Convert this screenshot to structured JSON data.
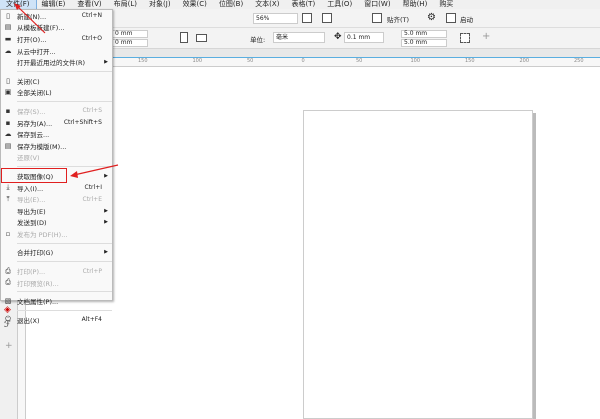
{
  "menubar": [
    "文件(F)",
    "编辑(E)",
    "查看(V)",
    "布局(L)",
    "对象(J)",
    "效果(C)",
    "位图(B)",
    "文本(X)",
    "表格(T)",
    "工具(O)",
    "窗口(W)",
    "帮助(H)",
    "购买"
  ],
  "toolbar": {
    "zoom": "56%",
    "snap": "贴齐(T)",
    "launch": "启动",
    "x_val": "0 mm",
    "y_val": "0 mm",
    "unit_label": "单位:",
    "unit": "毫米",
    "nudge": "0.1 mm",
    "dup_x": "5.0 mm",
    "dup_y": "5.0 mm"
  },
  "ruler": [
    "150",
    "100",
    "50",
    "0",
    "50",
    "100",
    "150",
    "200",
    "250"
  ],
  "file_menu": [
    {
      "icon": "new-icon",
      "label": "新建(N)...",
      "shortcut": "Ctrl+N"
    },
    {
      "icon": "template-icon",
      "label": "从模板新建(F)..."
    },
    {
      "icon": "folder-icon",
      "label": "打开(O)...",
      "shortcut": "Ctrl+O"
    },
    {
      "icon": "cloud-icon",
      "label": "从云中打开..."
    },
    {
      "label": "打开最近用过的文件(R)",
      "submenu": true
    },
    {
      "sep": true
    },
    {
      "icon": "close-icon",
      "label": "关闭(C)"
    },
    {
      "icon": "close-all-icon",
      "label": "全部关闭(L)"
    },
    {
      "sep": true
    },
    {
      "icon": "save-icon",
      "label": "保存(S)...",
      "shortcut": "Ctrl+S",
      "disabled": true
    },
    {
      "icon": "save-as-icon",
      "label": "另存为(A)...",
      "shortcut": "Ctrl+Shift+S"
    },
    {
      "icon": "cloud-save-icon",
      "label": "保存到云..."
    },
    {
      "icon": "save-template-icon",
      "label": "保存为模版(M)..."
    },
    {
      "label": "还原(V)",
      "disabled": true
    },
    {
      "sep": true
    },
    {
      "label": "获取图像(Q)",
      "submenu": true
    },
    {
      "icon": "import-icon",
      "label": "导入(I)...",
      "shortcut": "Ctrl+I"
    },
    {
      "icon": "export-icon",
      "label": "导出(E)...",
      "shortcut": "Ctrl+E",
      "disabled": true
    },
    {
      "label": "导出为(E)",
      "submenu": true
    },
    {
      "label": "发送到(D)",
      "submenu": true
    },
    {
      "icon": "pdf-icon",
      "label": "发布为 PDF(H)...",
      "disabled": true
    },
    {
      "sep": true
    },
    {
      "label": "合并打印(G)",
      "submenu": true
    },
    {
      "sep": true
    },
    {
      "icon": "print-icon",
      "label": "打印(P)...",
      "shortcut": "Ctrl+P",
      "disabled": true
    },
    {
      "icon": "print-preview-icon",
      "label": "打印预览(R)...",
      "disabled": true
    },
    {
      "sep": true
    },
    {
      "icon": "doc-properties-icon",
      "label": "文档属性(P)..."
    },
    {
      "sep": true
    },
    {
      "icon": "power-icon",
      "label": "退出(X)",
      "shortcut": "Alt+F4"
    }
  ],
  "colors": {
    "highlight": "#e02020",
    "accent": "#5aaee0"
  }
}
